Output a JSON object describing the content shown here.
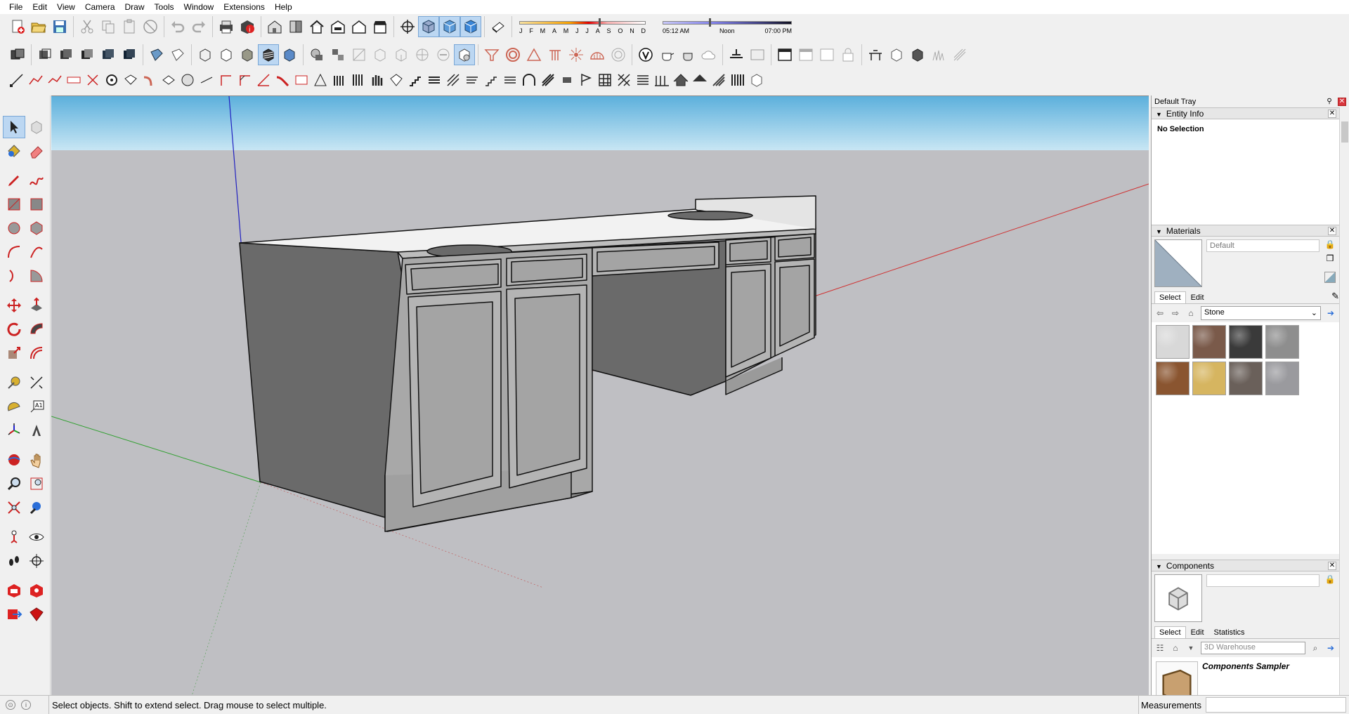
{
  "menu": [
    "File",
    "Edit",
    "View",
    "Camera",
    "Draw",
    "Tools",
    "Window",
    "Extensions",
    "Help"
  ],
  "shadows": {
    "months": [
      "J",
      "F",
      "M",
      "A",
      "M",
      "J",
      "J",
      "A",
      "S",
      "O",
      "N",
      "D"
    ],
    "time_start": "05:12 AM",
    "time_mid": "Noon",
    "time_end": "07:00 PM"
  },
  "tray": {
    "title": "Default Tray",
    "entity_info": {
      "title": "Entity Info",
      "selection": "No Selection"
    },
    "materials": {
      "title": "Materials",
      "name_placeholder": "Default",
      "tabs": [
        "Select",
        "Edit"
      ],
      "library": "Stone",
      "swatch_colors": [
        "#d8d8d8",
        "#7a5a4a",
        "#3a3a3a",
        "#8e8e8e",
        "#8a5530",
        "#d6b560",
        "#6a605a",
        "#9a9a9e"
      ]
    },
    "components": {
      "title": "Components",
      "tabs": [
        "Select",
        "Edit",
        "Statistics"
      ],
      "search_placeholder": "3D Warehouse",
      "list_item": "Components Sampler"
    }
  },
  "status": {
    "hint": "Select objects. Shift to extend select. Drag mouse to select multiple.",
    "measurements_label": "Measurements"
  },
  "colors": {
    "sky_top": "#6cb9e0",
    "ground": "#bfbfc3",
    "axis_red": "#d03030",
    "axis_green": "#30a030",
    "axis_blue": "#2020c0"
  }
}
